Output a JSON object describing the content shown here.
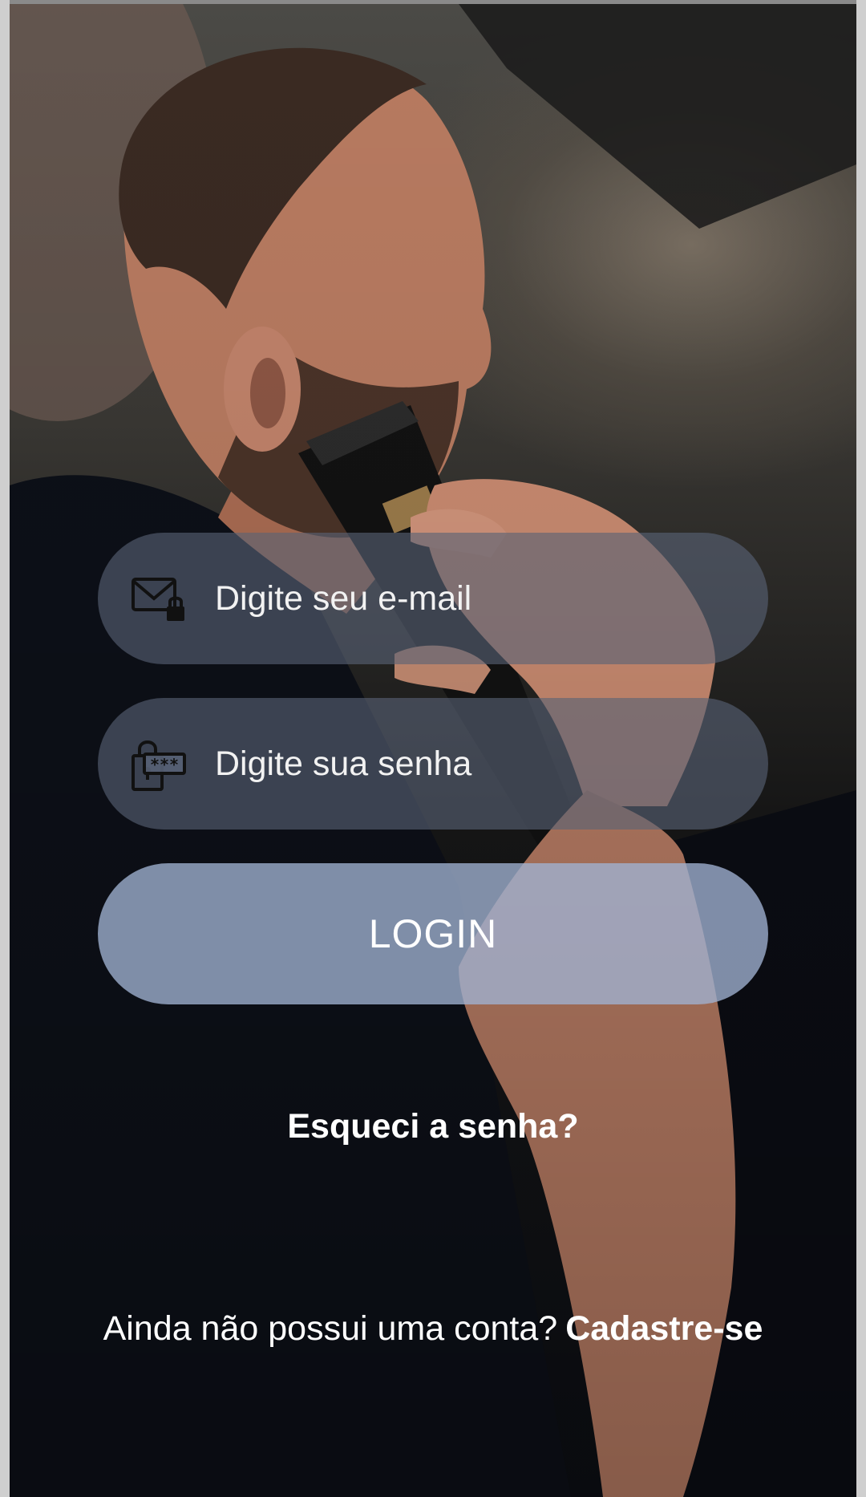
{
  "login_form": {
    "email": {
      "placeholder": "Digite seu e-mail",
      "value": "",
      "icon": "email-lock-icon"
    },
    "password": {
      "placeholder": "Digite sua senha",
      "value": "",
      "icon": "password-lock-icon"
    },
    "login_button_label": "LOGIN",
    "forgot_password_label": "Esqueci a senha?"
  },
  "signup": {
    "prompt": "Ainda não possui uma conta?",
    "link_label": "Cadastre-se"
  },
  "colors": {
    "field_background": "#586276",
    "button_background": "#a0b2d2",
    "text": "#ffffff"
  }
}
